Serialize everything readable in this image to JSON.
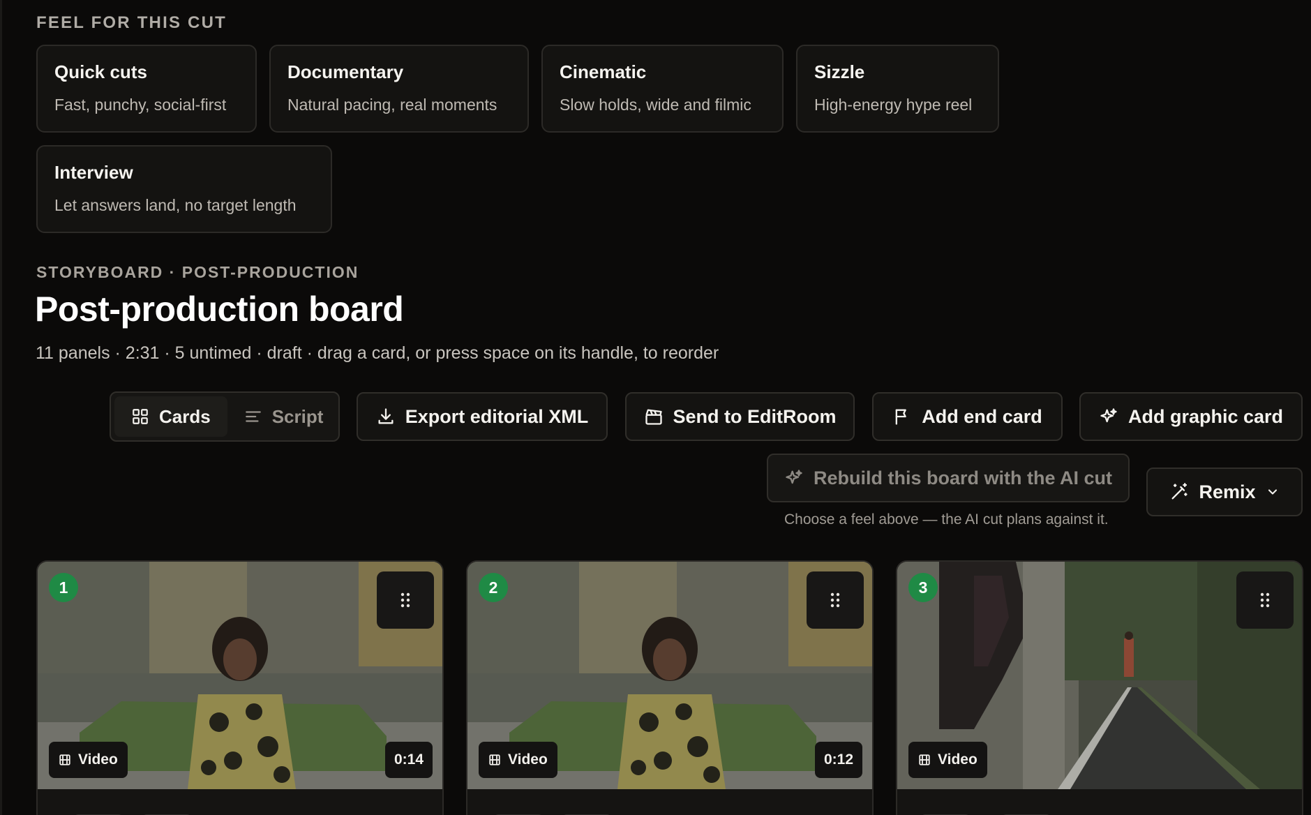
{
  "feel": {
    "label": "FEEL FOR THIS CUT",
    "options": [
      {
        "title": "Quick cuts",
        "desc": "Fast, punchy, social-first"
      },
      {
        "title": "Documentary",
        "desc": "Natural pacing, real moments"
      },
      {
        "title": "Cinematic",
        "desc": "Slow holds, wide and filmic"
      },
      {
        "title": "Sizzle",
        "desc": "High-energy hype reel"
      },
      {
        "title": "Interview",
        "desc": "Let answers land, no target length"
      }
    ]
  },
  "board": {
    "eyebrow": "STORYBOARD · POST-PRODUCTION",
    "title": "Post-production board",
    "subline": "11 panels · 2:31 · 5 untimed · draft · drag a card, or press space on its handle, to reorder"
  },
  "toolbar": {
    "view_cards": "Cards",
    "view_script": "Script",
    "export_xml": "Export editorial XML",
    "send_editroom": "Send to EditRoom",
    "add_end_card": "Add end card",
    "add_graphic_card": "Add graphic card",
    "rebuild_ai": "Rebuild this board with the AI cut",
    "remix": "Remix",
    "hint": "Choose a feel above — the AI cut plans against it."
  },
  "panels": [
    {
      "number": "1",
      "type": "Video",
      "duration": "0:14"
    },
    {
      "number": "2",
      "type": "Video",
      "duration": "0:12"
    },
    {
      "number": "3",
      "type": "Video",
      "duration": ""
    }
  ],
  "colors": {
    "background": "#0b0a09",
    "card": "#141311",
    "border": "#2c2a27",
    "badge_green": "#1f8a45"
  },
  "icons": {
    "cards": "grid-icon",
    "script": "lines-icon",
    "export": "download-icon",
    "send": "clapperboard-icon",
    "end_card": "flag-icon",
    "graphic": "sparkles-icon",
    "remix": "magic-wand-icon",
    "drag": "drag-handle-icon",
    "video": "film-icon"
  }
}
